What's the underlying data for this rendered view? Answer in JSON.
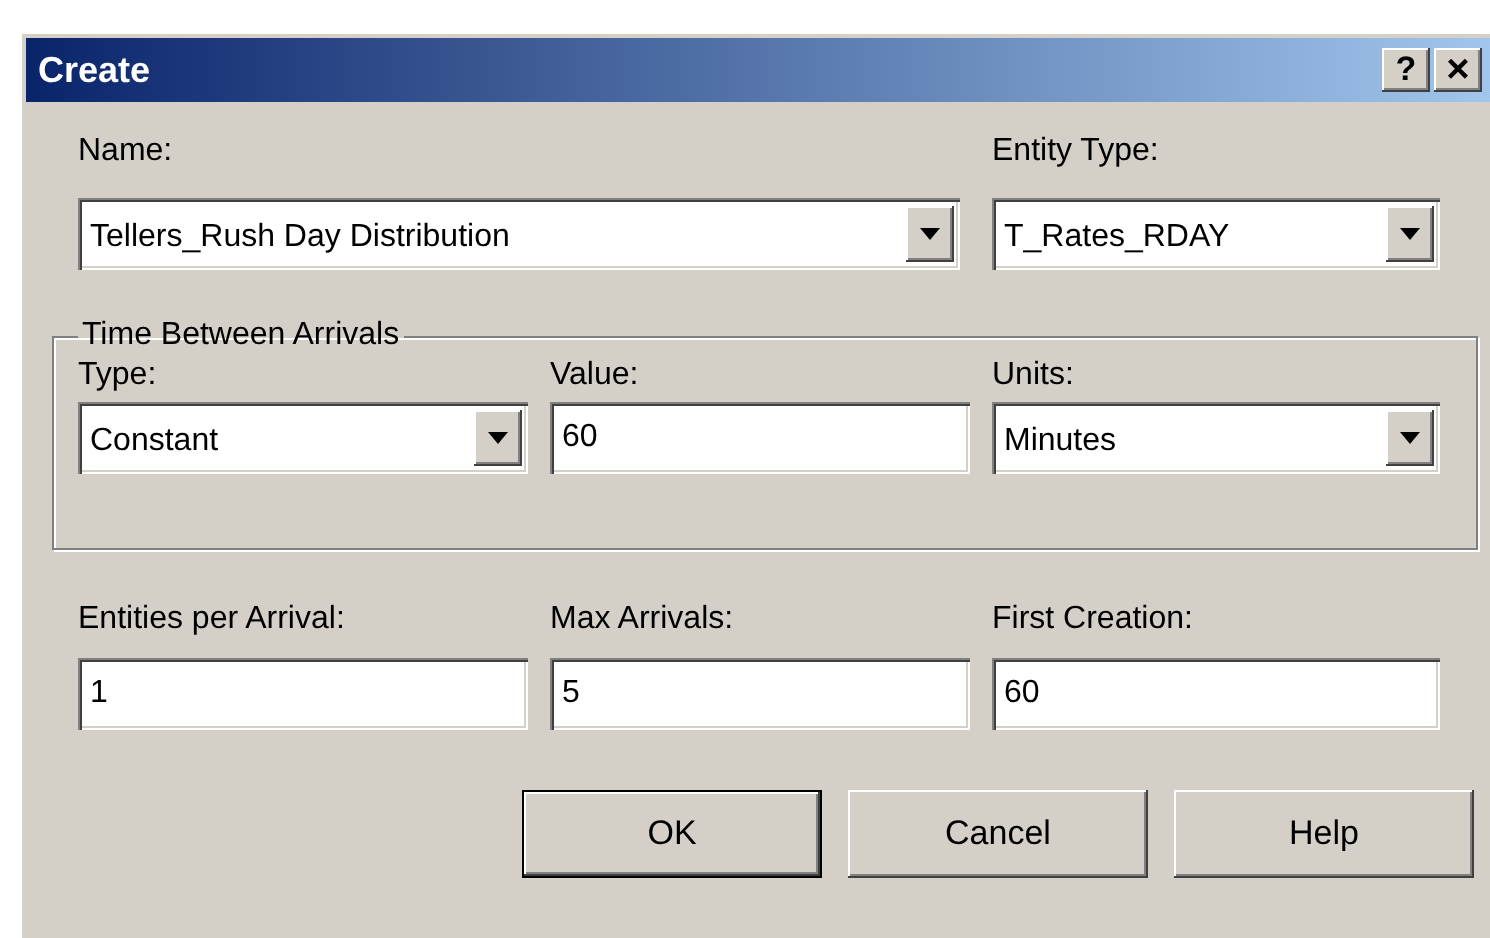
{
  "window": {
    "title": "Create",
    "buttons": [
      {
        "kind": "help",
        "label": "?"
      },
      {
        "kind": "close",
        "label": "×"
      }
    ]
  },
  "top_fields": [
    {
      "kind": "dropdown",
      "label": "Name:",
      "value": "Tellers_Rush Day Distribution"
    },
    {
      "kind": "dropdown",
      "label": "Entity Type:",
      "value": "T_Rates_RDAY"
    }
  ],
  "time_between_arrivals": {
    "title": "Time Between Arrivals",
    "fields": [
      {
        "kind": "dropdown",
        "label": "Type:",
        "value": "Constant"
      },
      {
        "kind": "text",
        "label": "Value:",
        "value": "60"
      },
      {
        "kind": "dropdown",
        "label": "Units:",
        "value": "Minutes"
      }
    ]
  },
  "fields": [
    {
      "kind": "text",
      "label": "Entities per Arrival:",
      "value": "1"
    },
    {
      "kind": "text",
      "label": "Max Arrivals:",
      "value": "5"
    },
    {
      "kind": "text",
      "label": "First Creation:",
      "value": "60"
    }
  ],
  "buttons": [
    {
      "label": "OK",
      "default": true
    },
    {
      "label": "Cancel",
      "default": false
    },
    {
      "label": "Help",
      "default": false
    }
  ]
}
